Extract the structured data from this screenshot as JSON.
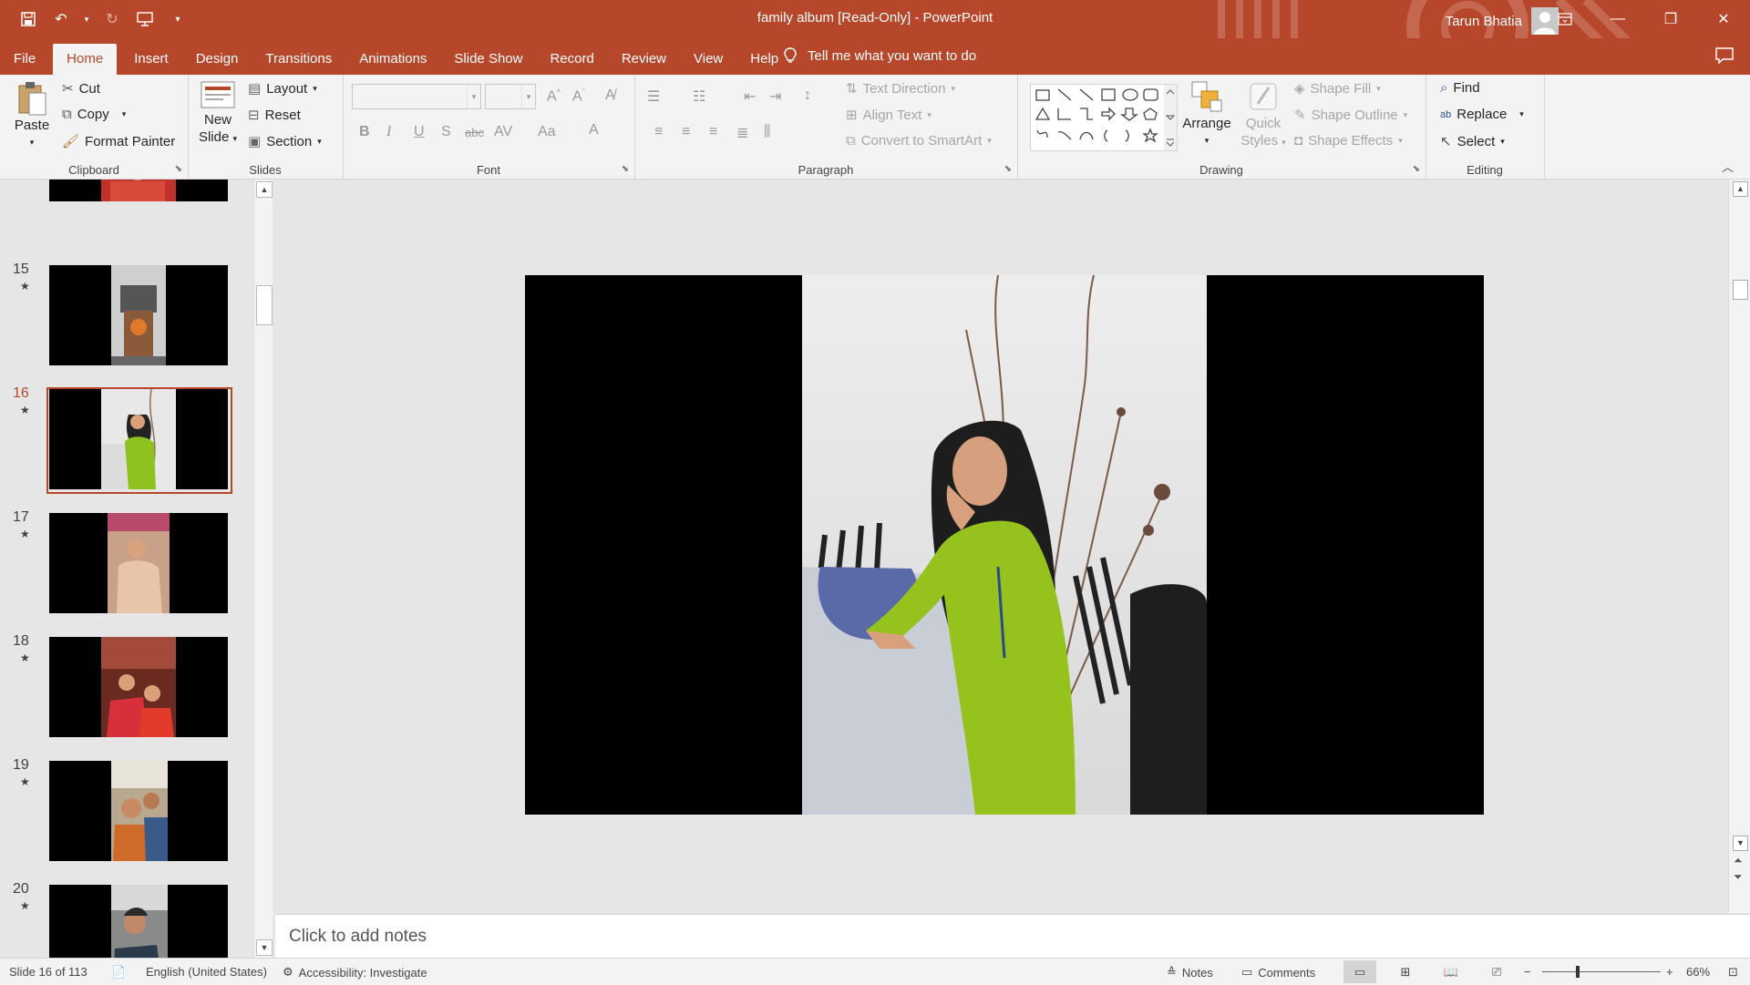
{
  "app": {
    "title": "family album [Read-Only]  -  PowerPoint",
    "user_name": "Tarun Bhatia",
    "accent_color": "#b7472a"
  },
  "tabs": [
    "File",
    "Home",
    "Insert",
    "Design",
    "Transitions",
    "Animations",
    "Slide Show",
    "Record",
    "Review",
    "View",
    "Help"
  ],
  "active_tab": "Home",
  "tell_me": "Tell me what you want to do",
  "ribbon": {
    "clipboard": {
      "paste": "Paste",
      "cut": "Cut",
      "copy": "Copy",
      "format_painter": "Format Painter",
      "label": "Clipboard"
    },
    "slides": {
      "new_slide_1": "New",
      "new_slide_2": "Slide",
      "layout": "Layout",
      "reset": "Reset",
      "section": "Section",
      "label": "Slides"
    },
    "font": {
      "label": "Font",
      "bold": "B",
      "italic": "I",
      "underline": "U",
      "shadow": "S",
      "strike": "abc",
      "case": "Aa"
    },
    "paragraph": {
      "text_direction": "Text Direction",
      "align_text": "Align Text",
      "convert_smartart": "Convert to SmartArt",
      "label": "Paragraph"
    },
    "drawing": {
      "arrange": "Arrange",
      "quick_1": "Quick",
      "quick_2": "Styles",
      "shape_fill": "Shape Fill",
      "shape_outline": "Shape Outline",
      "shape_effects": "Shape Effects",
      "label": "Drawing"
    },
    "editing": {
      "find": "Find",
      "replace": "Replace",
      "select": "Select",
      "label": "Editing"
    }
  },
  "thumbnails": [
    {
      "num": "15",
      "star": "★"
    },
    {
      "num": "16",
      "star": "★"
    },
    {
      "num": "17",
      "star": "★"
    },
    {
      "num": "18",
      "star": "★"
    },
    {
      "num": "19",
      "star": "★"
    },
    {
      "num": "20",
      "star": "★"
    }
  ],
  "selected_slide": "16",
  "notes_placeholder": "Click to add notes",
  "status": {
    "slide_info": "Slide 16 of 113",
    "language": "English (United States)",
    "accessibility": "Accessibility: Investigate",
    "notes": "Notes",
    "comments": "Comments",
    "zoom": "66%"
  }
}
